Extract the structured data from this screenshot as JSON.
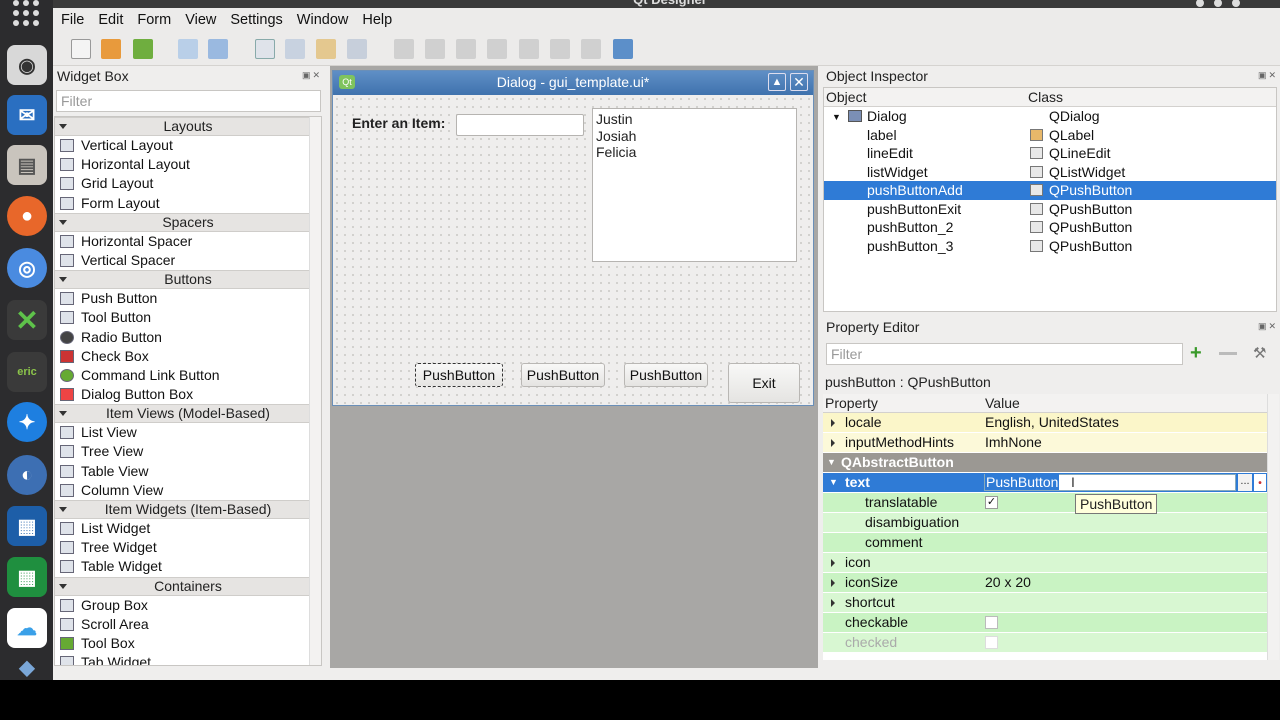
{
  "system": {
    "title": "Qt Designer"
  },
  "dock": {
    "items": [
      "app-grid",
      "screenshot",
      "mail",
      "files",
      "firefox",
      "chromium",
      "crossover",
      "eric",
      "safari",
      "earth",
      "writer",
      "calc",
      "icloud",
      "stack"
    ]
  },
  "menu": {
    "items": [
      "File",
      "Edit",
      "Form",
      "View",
      "Settings",
      "Window",
      "Help"
    ]
  },
  "widget_box": {
    "title": "Widget Box",
    "filter_placeholder": "Filter",
    "categories": [
      {
        "name": "Layouts",
        "items": [
          "Vertical Layout",
          "Horizontal Layout",
          "Grid Layout",
          "Form Layout"
        ]
      },
      {
        "name": "Spacers",
        "items": [
          "Horizontal Spacer",
          "Vertical Spacer"
        ]
      },
      {
        "name": "Buttons",
        "items": [
          "Push Button",
          "Tool Button",
          "Radio Button",
          "Check Box",
          "Command Link Button",
          "Dialog Button Box"
        ]
      },
      {
        "name": "Item Views (Model-Based)",
        "items": [
          "List View",
          "Tree View",
          "Table View",
          "Column View"
        ]
      },
      {
        "name": "Item Widgets (Item-Based)",
        "items": [
          "List Widget",
          "Tree Widget",
          "Table Widget"
        ]
      },
      {
        "name": "Containers",
        "items": [
          "Group Box",
          "Scroll Area",
          "Tool Box",
          "Tab Widget"
        ]
      }
    ]
  },
  "dialog": {
    "title": "Dialog - gui_template.ui*",
    "label": "Enter an Item:",
    "list_items": [
      "Justin",
      "Josiah",
      "Felicia"
    ],
    "buttons": [
      "PushButton",
      "PushButton",
      "PushButton",
      "Exit"
    ]
  },
  "object_inspector": {
    "title": "Object Inspector",
    "col_object": "Object",
    "col_class": "Class",
    "rows": [
      {
        "object": "Dialog",
        "class": "QDialog"
      },
      {
        "object": "label",
        "class": "QLabel"
      },
      {
        "object": "lineEdit",
        "class": "QLineEdit"
      },
      {
        "object": "listWidget",
        "class": "QListWidget"
      },
      {
        "object": "pushButtonAdd",
        "class": "QPushButton"
      },
      {
        "object": "pushButtonExit",
        "class": "QPushButton"
      },
      {
        "object": "pushButton_2",
        "class": "QPushButton"
      },
      {
        "object": "pushButton_3",
        "class": "QPushButton"
      }
    ],
    "selected_index": 4
  },
  "property_editor": {
    "title": "Property Editor",
    "filter_placeholder": "Filter",
    "object_label": "pushButton : QPushButton",
    "col_property": "Property",
    "col_value": "Value",
    "rows": [
      {
        "name": "locale",
        "value": "English, UnitedStates"
      },
      {
        "name": "inputMethodHints",
        "value": "ImhNone"
      },
      {
        "name": "QAbstractButton",
        "value": ""
      },
      {
        "name": "text",
        "value": "PushButton"
      },
      {
        "name": "translatable",
        "value": "✓"
      },
      {
        "name": "disambiguation",
        "value": ""
      },
      {
        "name": "comment",
        "value": ""
      },
      {
        "name": "icon",
        "value": ""
      },
      {
        "name": "iconSize",
        "value": "20 x 20"
      },
      {
        "name": "shortcut",
        "value": ""
      },
      {
        "name": "checkable",
        "value": ""
      },
      {
        "name": "checked",
        "value": ""
      }
    ],
    "tooltip": "PushButton",
    "ellipsis": "..."
  }
}
